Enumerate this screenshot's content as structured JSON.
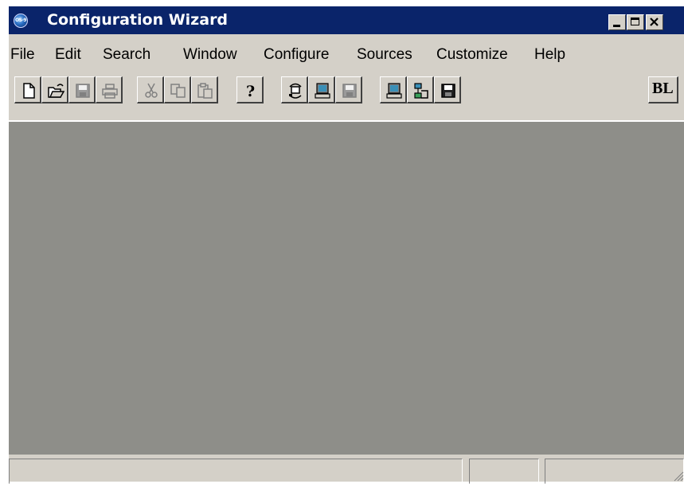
{
  "window": {
    "title": "Configuration Wizard",
    "app_icon_text": "OS-9"
  },
  "menubar": {
    "items": [
      {
        "label": "File"
      },
      {
        "label": "Edit"
      },
      {
        "label": "Search"
      },
      {
        "label": "Window"
      },
      {
        "label": "Configure"
      },
      {
        "label": "Sources"
      },
      {
        "label": "Customize"
      },
      {
        "label": "Help"
      }
    ]
  },
  "toolbar": {
    "buttons": [
      {
        "icon": "new-document-icon",
        "enabled": true
      },
      {
        "icon": "open-folder-icon",
        "enabled": true
      },
      {
        "icon": "save-disk-icon",
        "enabled": false
      },
      {
        "icon": "print-icon",
        "enabled": false
      },
      {
        "icon": "cut-scissors-icon",
        "enabled": false
      },
      {
        "icon": "copy-icon",
        "enabled": false
      },
      {
        "icon": "paste-icon",
        "enabled": false
      },
      {
        "icon": "help-question-icon",
        "enabled": true
      },
      {
        "icon": "network-connect-icon",
        "enabled": true
      },
      {
        "icon": "computer-icon",
        "enabled": true
      },
      {
        "icon": "save-disk-icon",
        "enabled": false
      },
      {
        "icon": "computer-icon",
        "enabled": true
      },
      {
        "icon": "module-tree-icon",
        "enabled": true
      },
      {
        "icon": "save-disk-icon",
        "enabled": true
      }
    ],
    "bl_label": "BL"
  },
  "colors": {
    "titlebar": "#0a246a",
    "chrome": "#d4d0c8",
    "workspace": "#8e8e89"
  }
}
